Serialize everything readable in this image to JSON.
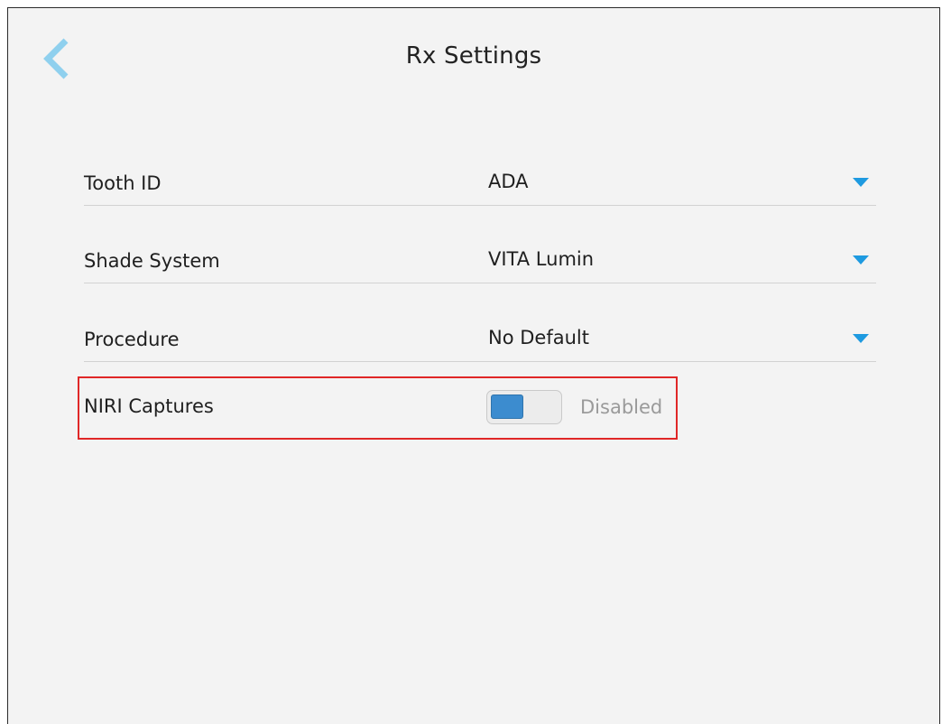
{
  "header": {
    "title": "Rx Settings",
    "back_icon": "chevron-left-icon"
  },
  "settings": [
    {
      "label": "Tooth ID",
      "value": "ADA"
    },
    {
      "label": "Shade System",
      "value": "VITA Lumin"
    },
    {
      "label": "Procedure",
      "value": "No Default"
    }
  ],
  "niri": {
    "label": "NIRI Captures",
    "status": "Disabled",
    "enabled": false
  },
  "colors": {
    "accent": "#1e9ae0",
    "toggle_knob": "#3c8ccf",
    "highlight": "#e02727",
    "background": "#f3f3f3"
  }
}
